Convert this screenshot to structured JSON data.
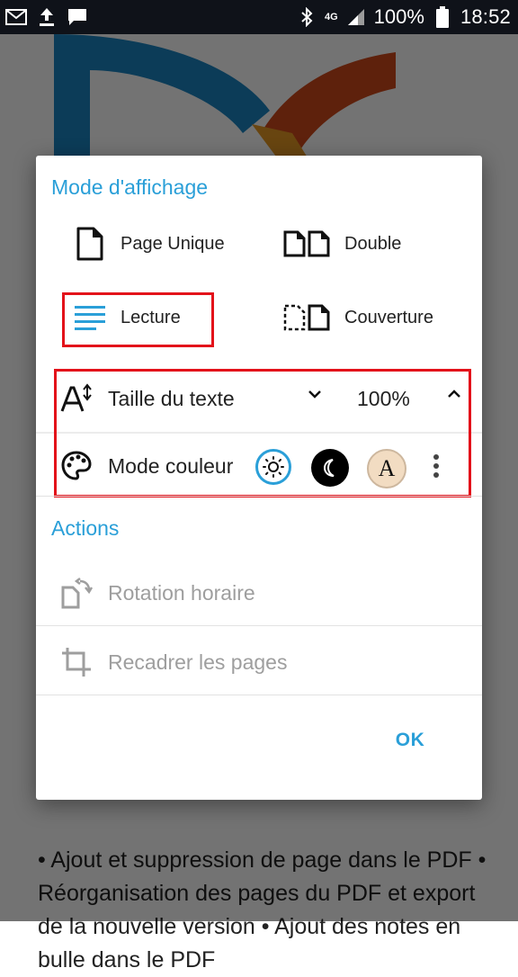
{
  "status_bar": {
    "battery": "100%",
    "time": "18:52",
    "network": "4G",
    "icons": [
      "gmail-icon",
      "upload-icon",
      "message-icon",
      "bluetooth-icon",
      "signal-icon",
      "battery-icon"
    ]
  },
  "background": {
    "text": "• Ajout et suppression de page dans le PDF • Réorganisation des pages du PDF et export de la nouvelle version • Ajout des notes en bulle dans le PDF"
  },
  "dialog": {
    "display_mode": {
      "title": "Mode d'affichage",
      "options": [
        {
          "label": "Page Unique",
          "icon": "single-page-icon"
        },
        {
          "label": "Double",
          "icon": "double-page-icon"
        },
        {
          "label": "Lecture",
          "icon": "reading-lines-icon",
          "selected": true
        },
        {
          "label": "Couverture",
          "icon": "cover-page-icon"
        }
      ]
    },
    "text_size": {
      "label": "Taille du texte",
      "value": "100%"
    },
    "color_mode": {
      "label": "Mode couleur",
      "options": [
        "day",
        "night",
        "sepia"
      ],
      "selected": "day",
      "sepia_letter": "A"
    },
    "actions": {
      "title": "Actions",
      "items": [
        {
          "label": "Rotation horaire",
          "icon": "rotate-clockwise-icon",
          "enabled": false
        },
        {
          "label": "Recadrer les pages",
          "icon": "crop-icon",
          "enabled": false
        }
      ]
    },
    "ok_label": "OK"
  },
  "colors": {
    "accent": "#2a9fd8",
    "highlight": "#e3121a",
    "sepia": "#f2dcc2"
  }
}
